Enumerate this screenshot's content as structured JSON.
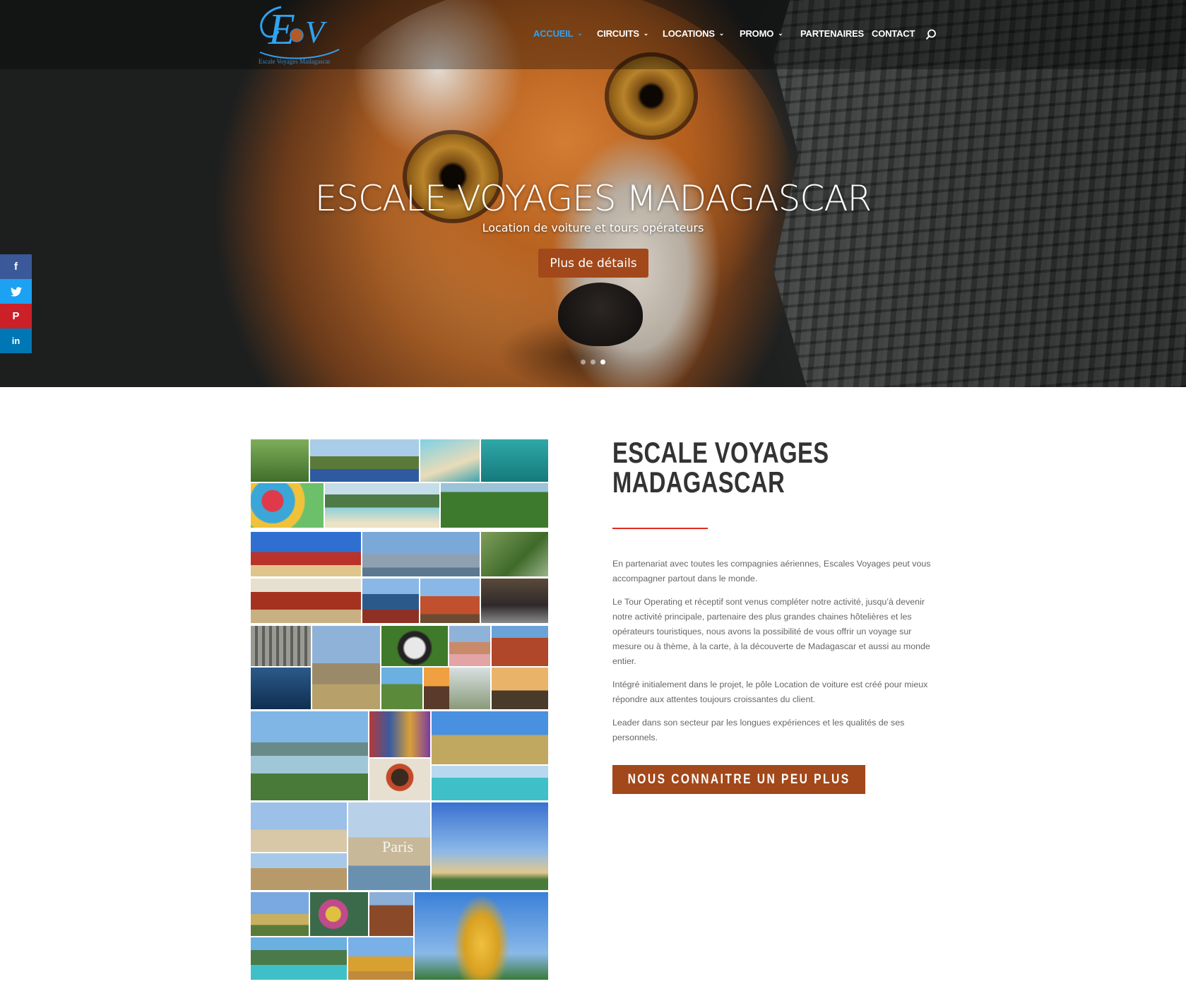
{
  "colors": {
    "accent": "#2ea3f2",
    "brand_brown": "#a2481a",
    "title_underline": "#e02b20",
    "facebook": "#3b5998",
    "twitter": "#1da1f2",
    "pinterest": "#cb2027",
    "linkedin": "#0077b5"
  },
  "header": {
    "logo_text": "Escale Voyages Madagascar",
    "nav": [
      {
        "label": "ACCUEIL",
        "has_dropdown": true,
        "active": true
      },
      {
        "label": "CIRCUITS",
        "has_dropdown": true,
        "active": false
      },
      {
        "label": "LOCATIONS",
        "has_dropdown": true,
        "active": false
      },
      {
        "label": "PROMO",
        "has_dropdown": true,
        "active": false
      },
      {
        "label": "PARTENAIRES",
        "has_dropdown": false,
        "active": false
      },
      {
        "label": "CONTACT",
        "has_dropdown": false,
        "active": false
      }
    ],
    "search_icon": "search-icon"
  },
  "hero": {
    "title": "ESCALE VOYAGES MADAGASCAR",
    "subtitle": "Location de voiture et tours opérateurs",
    "button_label": "Plus de détails",
    "slides_total": 3,
    "active_slide": 3
  },
  "social": [
    {
      "network": "facebook",
      "glyph": "f"
    },
    {
      "network": "twitter",
      "glyph": "t"
    },
    {
      "network": "pinterest",
      "glyph": "P"
    },
    {
      "network": "linkedin",
      "glyph": "in"
    }
  ],
  "collage": {
    "overlay_text": "Paris"
  },
  "about": {
    "title_line1": "ESCALE VOYAGES",
    "title_line2": "MADAGASCAR",
    "paragraphs": [
      "En partenariat avec toutes les compagnies aériennes, Escales Voyages peut vous accompagner partout dans le monde.",
      "Le Tour Operating et réceptif sont venus compléter notre activité, jusqu’à devenir notre activité principale, partenaire des plus grandes chaines hôtelières et les opérateurs touristiques, nous avons la possibilité de vous offrir un voyage sur mesure ou à thème, à la carte, à la découverte de Madagascar et aussi au monde entier.",
      "Intégré initialement dans le projet, le pôle Location de voiture est créé pour mieux répondre aux attentes toujours croissantes du client.",
      "Leader dans son secteur par les longues expériences et les qualités de ses personnels."
    ],
    "cta_label": "NOUS CONNAITRE UN PEU PLUS"
  }
}
